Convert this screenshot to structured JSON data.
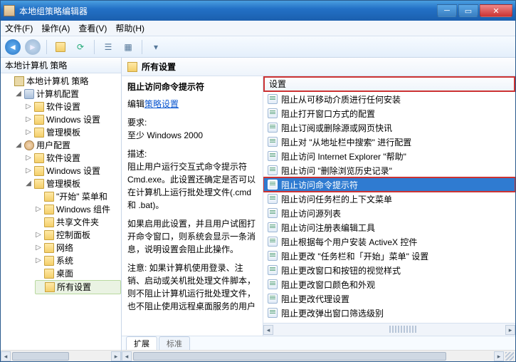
{
  "window": {
    "title": "本地组策略编辑器"
  },
  "menu": {
    "file": "文件(F)",
    "action": "操作(A)",
    "view": "查看(V)",
    "help": "帮助(H)"
  },
  "tree": {
    "header": "本地计算机 策略",
    "root": "本地计算机 策略",
    "comp": {
      "label": "计算机配置",
      "soft": "软件设置",
      "win": "Windows 设置",
      "admin": "管理模板"
    },
    "user": {
      "label": "用户配置",
      "soft": "软件设置",
      "win": "Windows 设置",
      "admin": {
        "label": "管理模板",
        "start": "\"开始\" 菜单和",
        "wincomp": "Windows 组件",
        "shared": "共享文件夹",
        "ctrl": "控制面板",
        "net": "网络",
        "sys": "系统",
        "desk": "桌面",
        "all": "所有设置"
      }
    }
  },
  "crumb": "所有设置",
  "desc": {
    "title": "阻止访问命令提示符",
    "edit_link_prefix": "编辑",
    "edit_link": "策略设置",
    "req_label": "要求:",
    "req_value": "至少 Windows 2000",
    "desc_label": "描述:",
    "p1": "阻止用户运行交互式命令提示符 Cmd.exe。此设置还确定是否可以在计算机上运行批处理文件(.cmd 和 .bat)。",
    "p2": "如果启用此设置，并且用户试图打开命令窗口，则系统会显示一条消息，说明设置会阻止此操作。",
    "p3": "注意: 如果计算机使用登录、注销、启动或关机批处理文件脚本，则不阻止计算机运行批处理文件，也不阻止使用远程桌面服务的用户"
  },
  "list": {
    "header": "设置",
    "items": [
      "阻止从可移动介质进行任何安装",
      "阻止打开窗口方式的配置",
      "阻止订阅或删除源或网页快讯",
      "阻止对 \"从地址栏中搜索\" 进行配置",
      "阻止访问 Internet Explorer \"帮助\"",
      "阻止访问 \"删除浏览历史记录\"",
      "阻止访问命令提示符",
      "阻止访问任务栏的上下文菜单",
      "阻止访问源列表",
      "阻止访问注册表编辑工具",
      "阻止根据每个用户安装 ActiveX 控件",
      "阻止更改 \"任务栏和「开始」菜单\" 设置",
      "阻止更改窗口和按钮的视觉样式",
      "阻止更改窗口颜色和外观",
      "阻止更改代理设置",
      "阻止更改弹出窗口筛选级别"
    ],
    "selected_index": 6
  },
  "tabs": {
    "extended": "扩展",
    "standard": "标准"
  }
}
